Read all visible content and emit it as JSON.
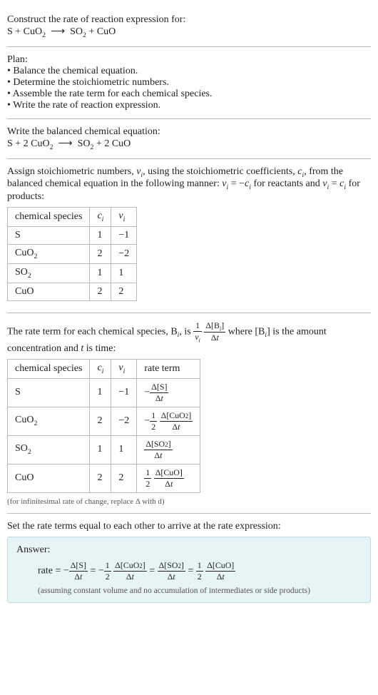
{
  "prompt": {
    "line1": "Construct the rate of reaction expression for:",
    "equation_lhs": "S + CuO",
    "equation_arrow": "⟶",
    "equation_rhs_a": "SO",
    "equation_rhs_b": " + CuO"
  },
  "plan": {
    "heading": "Plan:",
    "items": [
      "• Balance the chemical equation.",
      "• Determine the stoichiometric numbers.",
      "• Assemble the rate term for each chemical species.",
      "• Write the rate of reaction expression."
    ]
  },
  "balanced": {
    "heading": "Write the balanced chemical equation:",
    "lhs": "S + 2 CuO",
    "arrow": "⟶",
    "rhs_a": "SO",
    "rhs_b": " + 2 CuO"
  },
  "stoich": {
    "intro_a": "Assign stoichiometric numbers, ",
    "intro_b": ", using the stoichiometric coefficients, ",
    "intro_c": ", from the balanced chemical equation in the following manner: ",
    "intro_d": " for reactants and ",
    "intro_e": " for products:",
    "nu_i": "ν",
    "c_i": "c",
    "rel_react": "ν_i = −c_i",
    "rel_prod": "ν_i = c_i",
    "headers": [
      "chemical species",
      "c_i",
      "ν_i"
    ],
    "rows": [
      {
        "species": "S",
        "ci": "1",
        "nui": "−1"
      },
      {
        "species": "CuO2",
        "ci": "2",
        "nui": "−2"
      },
      {
        "species": "SO2",
        "ci": "1",
        "nui": "1"
      },
      {
        "species": "CuO",
        "ci": "2",
        "nui": "2"
      }
    ]
  },
  "rate_term": {
    "intro_a": "The rate term for each chemical species, B",
    "intro_b": ", is ",
    "intro_c": " where [B",
    "intro_d": "] is the amount concentration and ",
    "intro_t": "t",
    "intro_e": " is time:",
    "headers": [
      "chemical species",
      "c_i",
      "ν_i",
      "rate term"
    ],
    "rows": [
      {
        "species": "S",
        "ci": "1",
        "nui": "−1",
        "rate_num": "Δ[S]",
        "rate_den": "Δt",
        "prefix": "−",
        "coef_num": "",
        "coef_den": ""
      },
      {
        "species": "CuO2",
        "ci": "2",
        "nui": "−2",
        "rate_num": "Δ[CuO2]",
        "rate_den": "Δt",
        "prefix": "−",
        "coef_num": "1",
        "coef_den": "2"
      },
      {
        "species": "SO2",
        "ci": "1",
        "nui": "1",
        "rate_num": "Δ[SO2]",
        "rate_den": "Δt",
        "prefix": "",
        "coef_num": "",
        "coef_den": ""
      },
      {
        "species": "CuO",
        "ci": "2",
        "nui": "2",
        "rate_num": "Δ[CuO]",
        "rate_den": "Δt",
        "prefix": "",
        "coef_num": "1",
        "coef_den": "2"
      }
    ],
    "note": "(for infinitesimal rate of change, replace Δ with d)"
  },
  "final": {
    "heading": "Set the rate terms equal to each other to arrive at the rate expression:",
    "answer_label": "Answer:",
    "rate_label": "rate = ",
    "assumption": "(assuming constant volume and no accumulation of intermediates or side products)"
  },
  "chart_data": {
    "type": "table",
    "title": "Stoichiometric numbers and rate terms for S + 2 CuO2 ⟶ SO2 + 2 CuO",
    "columns": [
      "species",
      "c_i",
      "nu_i",
      "rate_term"
    ],
    "rows": [
      {
        "species": "S",
        "c_i": 1,
        "nu_i": -1,
        "rate_term": "-Δ[S]/Δt"
      },
      {
        "species": "CuO2",
        "c_i": 2,
        "nu_i": -2,
        "rate_term": "-(1/2)Δ[CuO2]/Δt"
      },
      {
        "species": "SO2",
        "c_i": 1,
        "nu_i": 1,
        "rate_term": "Δ[SO2]/Δt"
      },
      {
        "species": "CuO",
        "c_i": 2,
        "nu_i": 2,
        "rate_term": "(1/2)Δ[CuO]/Δt"
      }
    ],
    "rate_expression": "rate = -Δ[S]/Δt = -(1/2)Δ[CuO2]/Δt = Δ[SO2]/Δt = (1/2)Δ[CuO]/Δt"
  }
}
